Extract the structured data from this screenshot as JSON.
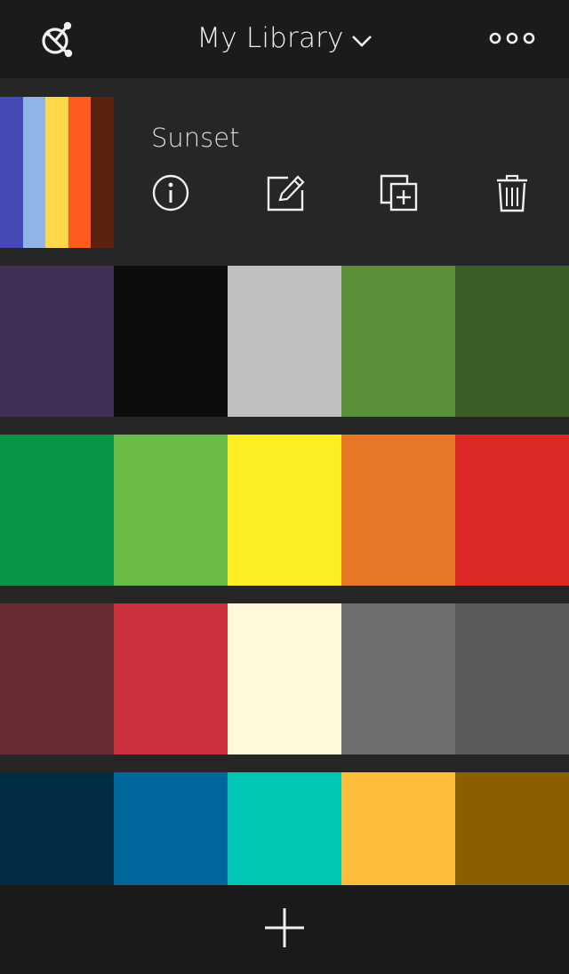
{
  "header": {
    "title": "My Library",
    "logo_icon": "color-wheel-logo-icon",
    "dropdown_icon": "chevron-down-icon",
    "more_icon": "more-options-icon"
  },
  "selected_theme": {
    "name": "Sunset",
    "colors": [
      "#4649b8",
      "#8fb4e6",
      "#ffd84a",
      "#ff5a1f",
      "#5c2210"
    ],
    "actions": [
      {
        "name": "info",
        "icon": "info-icon"
      },
      {
        "name": "edit",
        "icon": "edit-icon"
      },
      {
        "name": "duplicate",
        "icon": "duplicate-icon"
      },
      {
        "name": "delete",
        "icon": "trash-icon"
      }
    ]
  },
  "themes": [
    {
      "colors": [
        "#3f3055",
        "#0c0c0c",
        "#bec1bd",
        "#5c8f3a",
        "#3b5e28"
      ]
    },
    {
      "colors": [
        "#099447",
        "#6bba45",
        "#fcee23",
        "#e67825",
        "#dd2828"
      ]
    },
    {
      "colors": [
        "#682a33",
        "#cb303d",
        "#fff8d9",
        "#6e6e6e",
        "#5a5a5a"
      ]
    },
    {
      "colors": [
        "#002c44",
        "#00679d",
        "#00c6b4",
        "#ffbd3c",
        "#8b5e00"
      ]
    }
  ],
  "footer": {
    "add_icon": "plus-icon"
  },
  "colors": {
    "background": "#262626",
    "bar": "#1b1b1b",
    "icon": "#f0f0f0"
  }
}
